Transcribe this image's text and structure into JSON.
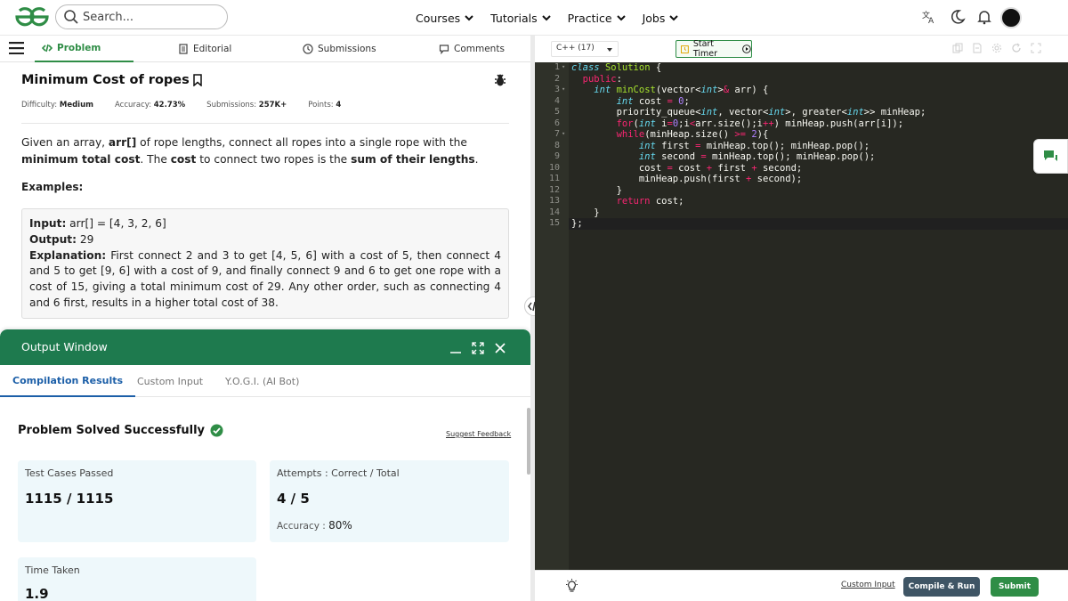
{
  "nav": {
    "search_placeholder": "Search...",
    "menu": [
      "Courses",
      "Tutorials",
      "Practice",
      "Jobs"
    ]
  },
  "left_tabs": [
    "Problem",
    "Editorial",
    "Submissions",
    "Comments"
  ],
  "problem": {
    "title": "Minimum Cost of ropes",
    "difficulty_label": "Difficulty:",
    "difficulty": "Medium",
    "accuracy_label": "Accuracy:",
    "accuracy": "42.73%",
    "submissions_label": "Submissions:",
    "submissions": "257K+",
    "points_label": "Points:",
    "points": "4",
    "desc": {
      "t1": "Given an array, ",
      "b1": "arr[]",
      "t2": " of rope lengths, connect all ropes into a single rope with the ",
      "b2": "minimum total cost",
      "t3": ". The ",
      "b3": "cost",
      "t4": " to connect two ropes is the ",
      "b4": "sum of their lengths",
      "t5": "."
    },
    "examples_heading": "Examples:",
    "example": {
      "input_label": "Input:",
      "input": " arr[] = [4, 3, 2, 6]",
      "output_label": "Output:",
      "output": " 29",
      "explanation_label": "Explanation:",
      "explanation": " First connect 2 and 3 to get [4, 5, 6] with a cost of 5, then connect 4 and 5 to get [9, 6] with a cost of 9, and finally connect 9 and 6 to get one rope with a cost of 15, giving a total minimum cost of 29. Any other order, such as connecting 4 and 6 first, results in a higher total cost of 38."
    }
  },
  "output_window": {
    "title": "Output Window",
    "tabs": [
      "Compilation Results",
      "Custom Input",
      "Y.O.G.I. (AI Bot)"
    ],
    "status": "Problem Solved Successfully",
    "feedback": "Suggest Feedback",
    "cards": {
      "tests_label": "Test Cases Passed",
      "tests_value": "1115 / 1115",
      "attempts_label": "Attempts : Correct / Total",
      "attempts_value": "4 / 5",
      "accuracy_label": "Accuracy : ",
      "accuracy_value": "80%",
      "time_label": "Time Taken",
      "time_value": "1.9"
    }
  },
  "editor": {
    "language": "C++ (17)",
    "timer": "Start Timer",
    "line_numbers": [
      "1",
      "2",
      "3",
      "4",
      "5",
      "6",
      "7",
      "8",
      "9",
      "10",
      "11",
      "12",
      "13",
      "14",
      "15"
    ],
    "custom_input": "Custom Input",
    "compile_run": "Compile & Run",
    "submit": "Submit"
  },
  "colors": {
    "brand_green": "#2f8d46",
    "output_header": "#1e7a4e",
    "active_tab_blue": "#1c5fa8",
    "editor_bg": "#272822",
    "compile_btn": "#3f5565",
    "submit_btn": "#2f8d46"
  }
}
